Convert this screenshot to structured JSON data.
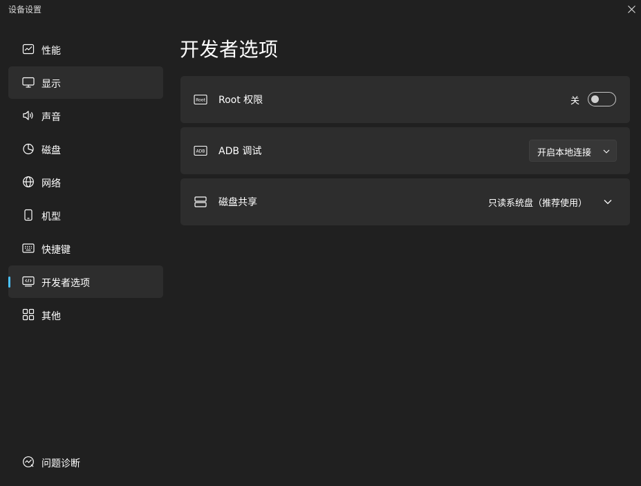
{
  "window": {
    "title": "设备设置"
  },
  "sidebar": {
    "items": [
      {
        "label": "性能",
        "icon": "performance-chart-icon"
      },
      {
        "label": "显示",
        "icon": "monitor-icon"
      },
      {
        "label": "声音",
        "icon": "speaker-icon"
      },
      {
        "label": "磁盘",
        "icon": "pie-chart-icon"
      },
      {
        "label": "网络",
        "icon": "globe-icon"
      },
      {
        "label": "机型",
        "icon": "phone-icon"
      },
      {
        "label": "快捷键",
        "icon": "keyboard-icon"
      },
      {
        "label": "开发者选项",
        "icon": "developer-code-icon",
        "selected": true
      },
      {
        "label": "其他",
        "icon": "grid-icon"
      }
    ],
    "diagnostics": {
      "label": "问题诊断",
      "icon": "diagnostics-icon"
    }
  },
  "main": {
    "title": "开发者选项",
    "settings": [
      {
        "label": "Root 权限",
        "icon": "root-icon",
        "control": "toggle",
        "state_label": "关",
        "on": false
      },
      {
        "label": "ADB 调试",
        "icon": "adb-icon",
        "control": "select",
        "value": "开启本地连接"
      },
      {
        "label": "磁盘共享",
        "icon": "disk-share-icon",
        "control": "expander",
        "value": "只读系统盘（推荐使用）"
      }
    ]
  },
  "colors": {
    "background": "#202020",
    "card": "#2d2d2d",
    "accent": "#4cc2ff"
  }
}
